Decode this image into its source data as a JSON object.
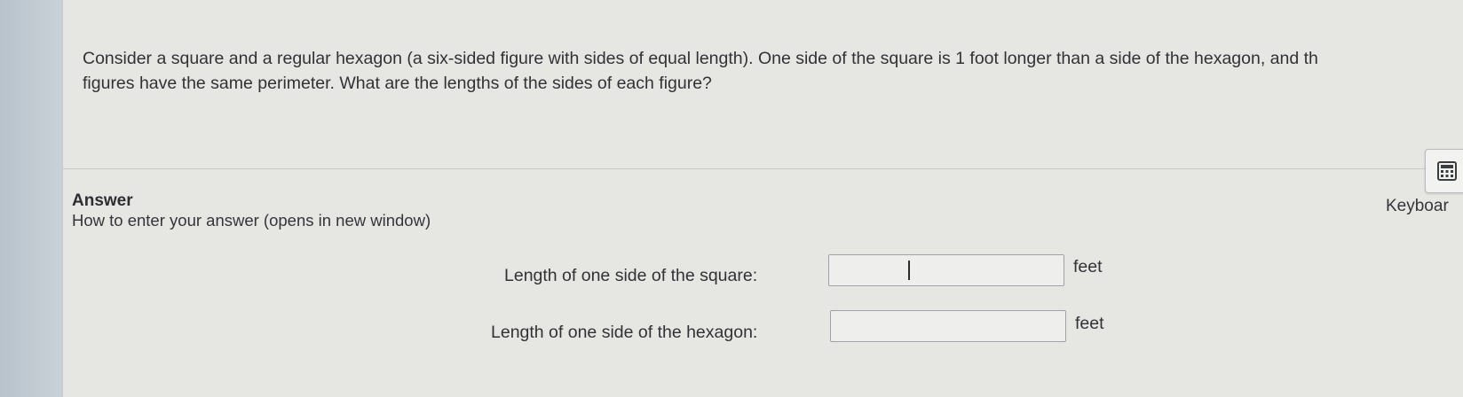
{
  "question": {
    "line1": "Consider a square and a regular hexagon (a six-sided figure with sides of equal length). One side of the square is 1 foot longer than a side of the hexagon, and th",
    "line2": "figures have the same perimeter. What are the lengths of the sides of each figure?"
  },
  "answer": {
    "heading": "Answer",
    "howto_link": "How to enter your answer (opens in new window)"
  },
  "tools": {
    "keyboard_label": "Keyboar",
    "calculator_icon": "calculator-icon"
  },
  "fields": [
    {
      "label": "Length of one side of the square:",
      "value": "",
      "unit": "feet"
    },
    {
      "label": "Length of one side of the hexagon:",
      "value": "",
      "unit": "feet"
    }
  ],
  "colors": {
    "panel_background": "#e6e7e3",
    "text": "#313236",
    "input_border": "#9ea3a6"
  }
}
